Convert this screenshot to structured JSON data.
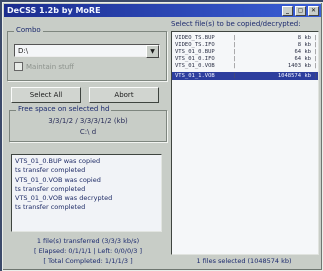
{
  "window": {
    "title": "DeCSS 1.2b by MoRE",
    "buttons": [
      "_",
      "▢",
      "✕"
    ]
  },
  "combo_group": {
    "label": "Combo",
    "drive_value": "D:\\",
    "checkbox_label": "Maintain stuff"
  },
  "buttons": {
    "select_all": "Select All",
    "abort": "Abort"
  },
  "free_space": {
    "label": "Free space on selected hd",
    "value": "3/3/1/2 / 3/3/3/1/2 (kb)",
    "drive": "C:\\ d"
  },
  "log": [
    "VTS_01_0.BUP was copied",
    "ts transfer completed",
    "VTS_01_0.VOB was copied",
    "ts transfer completed",
    "VTS_01_0.VOB was decrypted",
    "ts transfer completed"
  ],
  "status_left": {
    "transferred": "1 file(s) transferred (3/3/3 kb/s)",
    "elapsed": "[ Elapsed: 0/1/1/1 | Left: 0/0/0/3 ]",
    "total": "[ Total Completed: 1/1/1/3 ]"
  },
  "right_panel": {
    "header": "Select file(s) to be copied/decrypted:",
    "files": [
      {
        "name": "VIDEO_TS.BUP",
        "size": "8 kb"
      },
      {
        "name": "VIDEO_TS.IFO",
        "size": "8 kb"
      },
      {
        "name": "VTS_01_0.BUP",
        "size": "64 kb"
      },
      {
        "name": "VTS_01_0.IFO",
        "size": "64 kb"
      },
      {
        "name": "VTS_01_0.VOB",
        "size": "1403 kb"
      },
      {
        "name": "VTS_01_1.VOB",
        "size": "1048574 kb"
      }
    ],
    "selected_index": 5,
    "status": "1 files selected (1048574 kb)"
  },
  "colors": {
    "title_bar": "#1b2c8e",
    "window_bg": "#c8cdc7",
    "selection": "#2d3e9e"
  }
}
